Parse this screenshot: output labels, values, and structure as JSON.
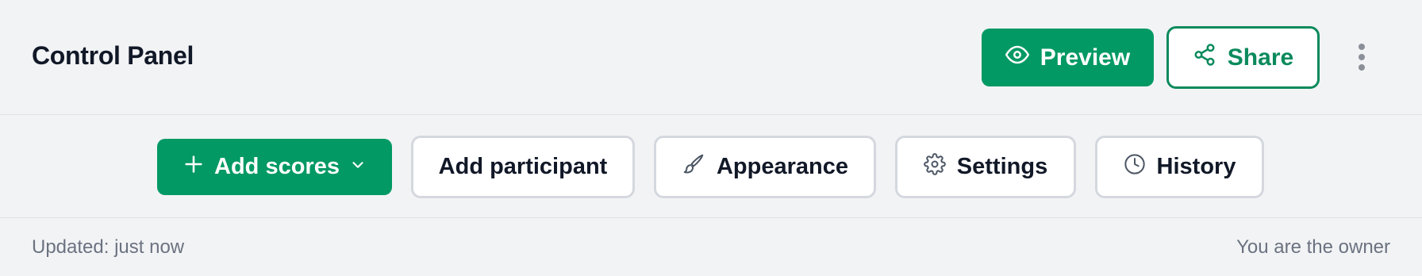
{
  "header": {
    "title": "Control Panel",
    "preview_label": "Preview",
    "share_label": "Share",
    "icons": {
      "preview": "eye-icon",
      "share": "share-icon",
      "more": "more-vertical-icon"
    }
  },
  "toolbar": {
    "add_scores_label": "Add scores",
    "add_participant_label": "Add participant",
    "appearance_label": "Appearance",
    "settings_label": "Settings",
    "history_label": "History",
    "icons": {
      "add_scores": "plus-icon",
      "dropdown": "chevron-down-icon",
      "appearance": "paintbrush-icon",
      "settings": "gear-icon",
      "history": "clock-icon"
    }
  },
  "footer": {
    "updated": "Updated: just now",
    "owner": "You are the owner"
  },
  "colors": {
    "primary": "#029964",
    "primary_outline": "#0b8a5c",
    "background": "#f2f3f5",
    "muted_text": "#6b7280"
  }
}
